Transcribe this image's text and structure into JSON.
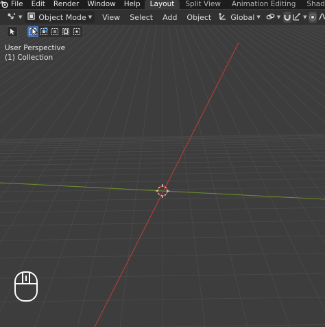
{
  "app": {
    "logo_icon": "blender-logo-icon",
    "menu": [
      "File",
      "Edit",
      "Render",
      "Window",
      "Help"
    ],
    "workspace_tabs": [
      {
        "label": "Layout",
        "active": true
      },
      {
        "label": "Split View",
        "active": false
      },
      {
        "label": "Animation Editing",
        "active": false
      },
      {
        "label": "Shading",
        "active": false
      }
    ]
  },
  "header": {
    "editor_type_icon": "viewport-editor-icon",
    "mode": "Object Mode",
    "menus": [
      "View",
      "Select",
      "Add",
      "Object"
    ],
    "transform_orientation": "Global",
    "pivot_icon": "link-icon",
    "snap_icon": "magnet-icon",
    "proportional_icon": "proportional-edit-icon",
    "falloff_icon": "falloff-curve-icon"
  },
  "toolbar": {
    "tools": [
      "select-tool-icon",
      "select-box-icon",
      "select-extend-icon",
      "select-subtract-icon",
      "select-invert-icon",
      "select-intersect-icon"
    ]
  },
  "viewport": {
    "view_name": "User Perspective",
    "collection": "(1) Collection",
    "colors": {
      "background": "#3d3d3d",
      "grid": "#4a4a4a",
      "x_axis": "#b83c3c",
      "y_axis": "#6d8a2a",
      "accent": "#4772b3"
    }
  },
  "status": {
    "mouse_icon": "mouse-icon"
  }
}
